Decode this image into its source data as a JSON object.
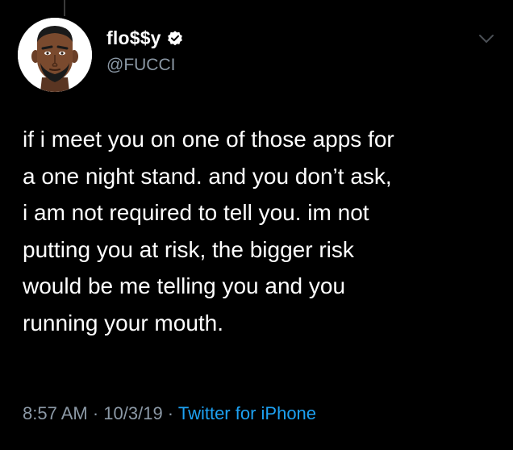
{
  "colors": {
    "background": "#000000",
    "text": "#ffffff",
    "secondary_text": "#8b98a5",
    "link": "#1da1f2",
    "verified_badge": "#ffffff"
  },
  "author": {
    "display_name": "flo$$y",
    "handle": "@FUCCI",
    "verified": true,
    "avatar_icon": "cartoon-man-avatar",
    "verified_icon": "verified-badge-icon"
  },
  "menu": {
    "icon": "chevron-down-icon"
  },
  "tweet": {
    "text": "if i meet you on one of those apps for\na one night stand. and you don’t ask,\ni am not required to tell you. im not\nputting you at risk, the bigger risk\nwould be me telling you and you\nrunning your mouth."
  },
  "meta": {
    "time": "8:57 AM",
    "separator": " · ",
    "date": "10/3/19",
    "source": "Twitter for iPhone"
  }
}
